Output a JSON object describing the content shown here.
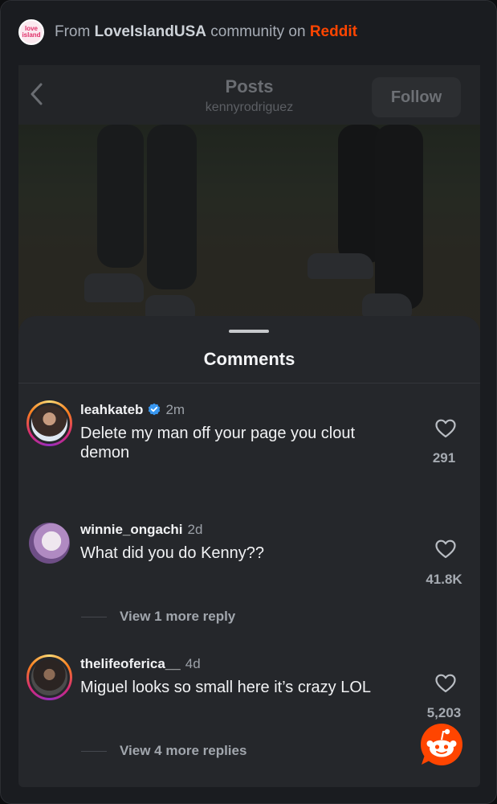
{
  "source": {
    "prefix": "From",
    "community": "LoveIslandUSA",
    "middle": "community on",
    "platform": "Reddit",
    "community_logo_line1": "love",
    "community_logo_line2": "island"
  },
  "post": {
    "header_title": "Posts",
    "header_subtitle": "kennyrodriguez",
    "follow_label": "Follow",
    "back_icon": "chevron-left-icon"
  },
  "comments_sheet": {
    "title": "Comments",
    "comments": [
      {
        "username": "leahkateb",
        "verified": true,
        "time": "2m",
        "text": "Delete my man off your page you clout demon",
        "likes": "291"
      },
      {
        "username": "winnie_ongachi",
        "verified": false,
        "time": "2d",
        "text": "What did you do Kenny??",
        "likes": "41.8K",
        "view_replies": "View 1 more reply"
      },
      {
        "username": "thelifeoferica__",
        "verified": false,
        "time": "4d",
        "text": "Miguel looks so small here it’s crazy LOL",
        "likes": "5,203",
        "view_replies": "View 4 more replies"
      }
    ]
  },
  "colors": {
    "reddit_orange": "#ff4500",
    "verified_blue": "#3897f0",
    "sheet_bg": "#25272b"
  }
}
